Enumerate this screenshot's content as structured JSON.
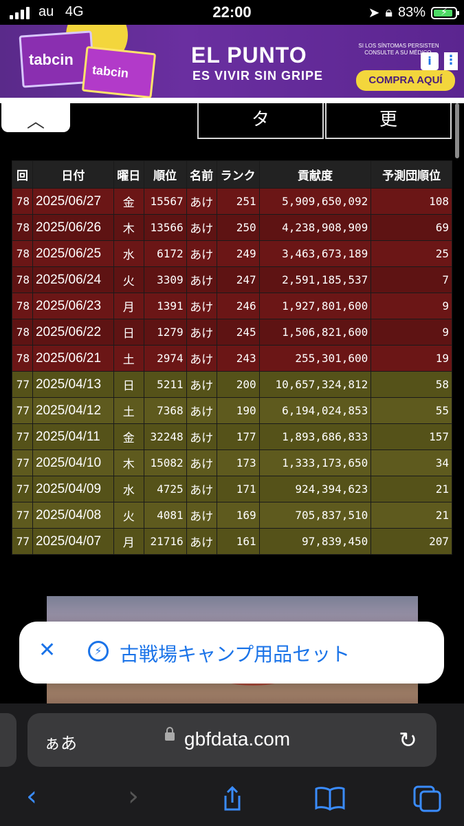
{
  "status": {
    "carrier": "au",
    "network": "4G",
    "time": "22:00",
    "battery": "83%",
    "icons": [
      "signal-icon",
      "location-icon",
      "orientation-lock-icon",
      "battery-charging-icon"
    ]
  },
  "ad": {
    "brand": "tabcin",
    "headline": "EL PUNTO",
    "subline": "ES VIVIR SIN GRIPE",
    "disclaimer": "SI LOS SÍNTOMAS PERSISTEN CONSULTE A SU MÉDICO.",
    "cta": "COMPRA AQUÍ",
    "colors": {
      "background": "#5a2a8a",
      "accent": "#f3d63c"
    }
  },
  "tabs": [
    {
      "label": "タ"
    },
    {
      "label": "更"
    }
  ],
  "table": {
    "headers": [
      "回",
      "日付",
      "曜日",
      "順位",
      "名前",
      "ランク",
      "貢献度",
      "予測団順位"
    ],
    "rows": [
      {
        "kai": "78",
        "date": "2025/06/27",
        "day": "金",
        "rank": "15567",
        "name": "あけ",
        "level": "251",
        "contribution": "5,909,650,092",
        "predicted": "108"
      },
      {
        "kai": "78",
        "date": "2025/06/26",
        "day": "木",
        "rank": "13566",
        "name": "あけ",
        "level": "250",
        "contribution": "4,238,908,909",
        "predicted": "69"
      },
      {
        "kai": "78",
        "date": "2025/06/25",
        "day": "水",
        "rank": "6172",
        "name": "あけ",
        "level": "249",
        "contribution": "3,463,673,189",
        "predicted": "25"
      },
      {
        "kai": "78",
        "date": "2025/06/24",
        "day": "火",
        "rank": "3309",
        "name": "あけ",
        "level": "247",
        "contribution": "2,591,185,537",
        "predicted": "7"
      },
      {
        "kai": "78",
        "date": "2025/06/23",
        "day": "月",
        "rank": "1391",
        "name": "あけ",
        "level": "246",
        "contribution": "1,927,801,600",
        "predicted": "9"
      },
      {
        "kai": "78",
        "date": "2025/06/22",
        "day": "日",
        "rank": "1279",
        "name": "あけ",
        "level": "245",
        "contribution": "1,506,821,600",
        "predicted": "9"
      },
      {
        "kai": "78",
        "date": "2025/06/21",
        "day": "土",
        "rank": "2974",
        "name": "あけ",
        "level": "243",
        "contribution": "255,301,600",
        "predicted": "19"
      },
      {
        "kai": "77",
        "date": "2025/04/13",
        "day": "日",
        "rank": "5211",
        "name": "あけ",
        "level": "200",
        "contribution": "10,657,324,812",
        "predicted": "58"
      },
      {
        "kai": "77",
        "date": "2025/04/12",
        "day": "土",
        "rank": "7368",
        "name": "あけ",
        "level": "190",
        "contribution": "6,194,024,853",
        "predicted": "55"
      },
      {
        "kai": "77",
        "date": "2025/04/11",
        "day": "金",
        "rank": "32248",
        "name": "あけ",
        "level": "177",
        "contribution": "1,893,686,833",
        "predicted": "157"
      },
      {
        "kai": "77",
        "date": "2025/04/10",
        "day": "木",
        "rank": "15082",
        "name": "あけ",
        "level": "173",
        "contribution": "1,333,173,650",
        "predicted": "34"
      },
      {
        "kai": "77",
        "date": "2025/04/09",
        "day": "水",
        "rank": "4725",
        "name": "あけ",
        "level": "171",
        "contribution": "924,394,623",
        "predicted": "21"
      },
      {
        "kai": "77",
        "date": "2025/04/08",
        "day": "火",
        "rank": "4081",
        "name": "あけ",
        "level": "169",
        "contribution": "705,837,510",
        "predicted": "21"
      },
      {
        "kai": "77",
        "date": "2025/04/07",
        "day": "月",
        "rank": "21716",
        "name": "あけ",
        "level": "161",
        "contribution": "97,839,450",
        "predicted": "207"
      }
    ],
    "colors": {
      "kai78": "#6b1616",
      "kai77": "#5e5a1e"
    }
  },
  "popup": {
    "text": "古戦場キャンプ用品セット"
  },
  "browser": {
    "text_size_label": "ぁあ",
    "domain": "gbfdata.com"
  }
}
